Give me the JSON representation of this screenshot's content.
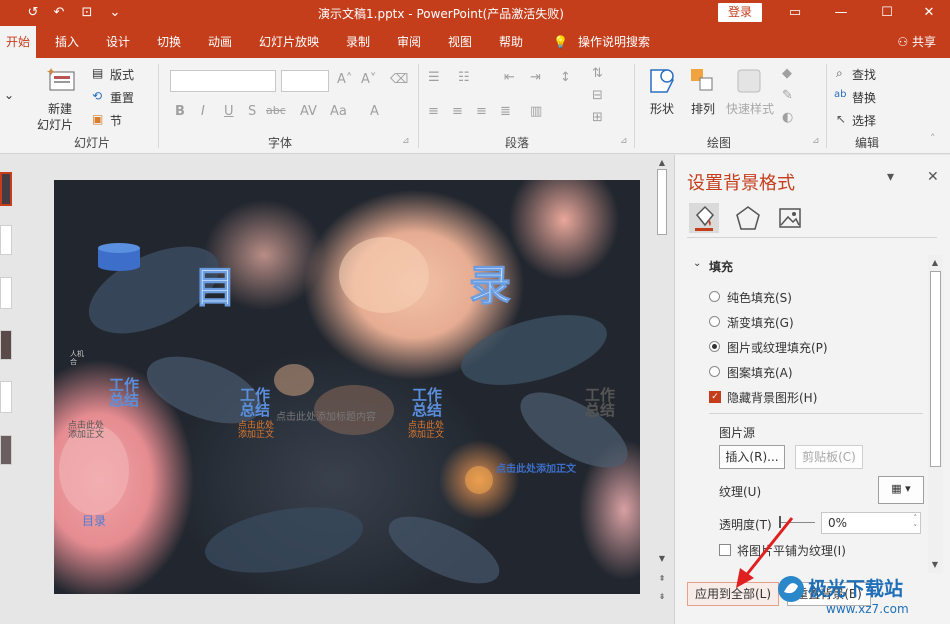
{
  "titlebar": {
    "doc_title": "演示文稿1.pptx  -  PowerPoint(产品激活失败)",
    "login": "登录",
    "icons": [
      "autosave-icon",
      "undo-icon",
      "present-icon",
      "touch-mode-icon",
      "customize-icon"
    ]
  },
  "menu": {
    "tabs": [
      "开始",
      "插入",
      "设计",
      "切换",
      "动画",
      "幻灯片放映",
      "录制",
      "审阅",
      "视图",
      "帮助"
    ],
    "tell_me": "操作说明搜索",
    "share": "共享"
  },
  "ribbon": {
    "slides_group": {
      "label": "幻灯片",
      "new_slide": [
        "新建",
        "幻灯片"
      ],
      "layout": "版式",
      "reset": "重置",
      "section": "节"
    },
    "font_group": {
      "label": "字体",
      "font_buttons": [
        "B",
        "I",
        "U",
        "S",
        "abc",
        "AV",
        "Aa"
      ]
    },
    "paragraph_group": {
      "label": "段落"
    },
    "drawing_group": {
      "label": "绘图",
      "shapes": "形状",
      "arrange": "排列",
      "quick_styles": "快速样式"
    },
    "editing_group": {
      "label": "编辑",
      "find": "查找",
      "replace": "替换",
      "select": "选择"
    }
  },
  "slide": {
    "heading_left": "目",
    "heading_right": "录",
    "sections": [
      {
        "title": [
          "工作",
          "总结"
        ],
        "sub": [
          "点击此处",
          "添加正文"
        ]
      },
      {
        "title": [
          "工作",
          "总结"
        ],
        "sub": [
          "点击此处",
          "添加正文"
        ]
      },
      {
        "title": [
          "工作",
          "总结"
        ],
        "sub": [
          "点击此处",
          "添加正文"
        ]
      },
      {
        "title": [
          "工作",
          "总结"
        ],
        "sub": []
      }
    ],
    "left_tiny": [
      "人机",
      "合"
    ],
    "small_left_sub": [
      "点击此处",
      "添加正文"
    ],
    "middle_caption": "点击此处添加标题内容",
    "right_caption": "点击此处添加正文",
    "bottom_label": "目录"
  },
  "format_pane": {
    "title": "设置背景格式",
    "section": "填充",
    "options": [
      {
        "label": "纯色填充(S)",
        "selected": false
      },
      {
        "label": "渐变填充(G)",
        "selected": false
      },
      {
        "label": "图片或纹理填充(P)",
        "selected": true
      },
      {
        "label": "图案填充(A)",
        "selected": false
      }
    ],
    "hide_bg_graphics": "隐藏背景图形(H)",
    "picture_source": "图片源",
    "insert_btn": "插入(R)...",
    "clipboard_btn": "剪贴板(C)",
    "texture": "纹理(U)",
    "transparency": "透明度(T)",
    "transparency_value": "0%",
    "tile_checkbox": "将图片平铺为纹理(I)",
    "apply_all": "应用到全部(L)",
    "reset_bg": "重置背景(B)"
  },
  "watermark": {
    "name": "极光下载站",
    "url": "www.xz7.com"
  },
  "colors": {
    "accent": "#c43e1c",
    "ribbon_bg": "#f3f3f3",
    "arrow": "#e02020"
  }
}
